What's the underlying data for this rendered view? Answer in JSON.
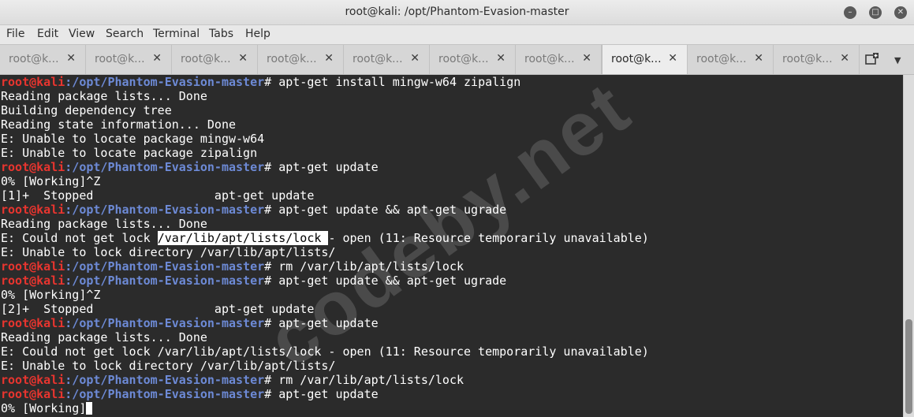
{
  "window": {
    "title": "root@kali: /opt/Phantom-Evasion-master",
    "controls": {
      "minimize": "–",
      "maximize": "□",
      "close": "✕"
    }
  },
  "menu": [
    "File",
    "Edit",
    "View",
    "Search",
    "Terminal",
    "Tabs",
    "Help"
  ],
  "tabs": [
    {
      "label": "root@k..."
    },
    {
      "label": "root@k..."
    },
    {
      "label": "root@k..."
    },
    {
      "label": "root@k..."
    },
    {
      "label": "root@k..."
    },
    {
      "label": "root@k..."
    },
    {
      "label": "root@k..."
    },
    {
      "label": "root@k..."
    },
    {
      "label": "root@k..."
    },
    {
      "label": "root@k..."
    }
  ],
  "active_tab": 7,
  "tab_close_glyph": "✕",
  "prompt": {
    "user": "root@kali",
    "path": ":/opt/Phantom-Evasion-master",
    "symbol": "# "
  },
  "lines": [
    {
      "prompt": true,
      "text": "apt-get install mingw-w64 zipalign"
    },
    {
      "text": "Reading package lists... Done"
    },
    {
      "text": "Building dependency tree"
    },
    {
      "text": "Reading state information... Done"
    },
    {
      "text": "E: Unable to locate package mingw-w64"
    },
    {
      "text": "E: Unable to locate package zipalign"
    },
    {
      "prompt": true,
      "text": "apt-get update"
    },
    {
      "text": "0% [Working]^Z"
    },
    {
      "text": "[1]+  Stopped                 apt-get update"
    },
    {
      "prompt": true,
      "text": "apt-get update && apt-get ugrade"
    },
    {
      "text": "Reading package lists... Done"
    },
    {
      "text": "E: Could not get lock ",
      "highlight": "/var/lib/apt/lists/lock ",
      "after": "- open (11: Resource temporarily unavailable)"
    },
    {
      "text": "E: Unable to lock directory /var/lib/apt/lists/"
    },
    {
      "prompt": true,
      "text": "rm /var/lib/apt/lists/lock"
    },
    {
      "prompt": true,
      "text": "apt-get update && apt-get ugrade"
    },
    {
      "text": "0% [Working]^Z"
    },
    {
      "text": "[2]+  Stopped                 apt-get update"
    },
    {
      "prompt": true,
      "text": "apt-get update"
    },
    {
      "text": "Reading package lists... Done"
    },
    {
      "text": "E: Could not get lock /var/lib/apt/lists/lock - open (11: Resource temporarily unavailable)"
    },
    {
      "text": "E: Unable to lock directory /var/lib/apt/lists/"
    },
    {
      "prompt": true,
      "text": "rm /var/lib/apt/lists/lock"
    },
    {
      "prompt": true,
      "text": "apt-get update"
    },
    {
      "text": "0% [Working]",
      "cursor": true
    }
  ],
  "watermark": "codeby.net",
  "colors": {
    "terminal_bg": "#2b2b2b",
    "terminal_fg": "#ffffff",
    "prompt_user": "#e8352f",
    "prompt_path": "#6d8ad6",
    "selection_bg": "#ffffff"
  }
}
